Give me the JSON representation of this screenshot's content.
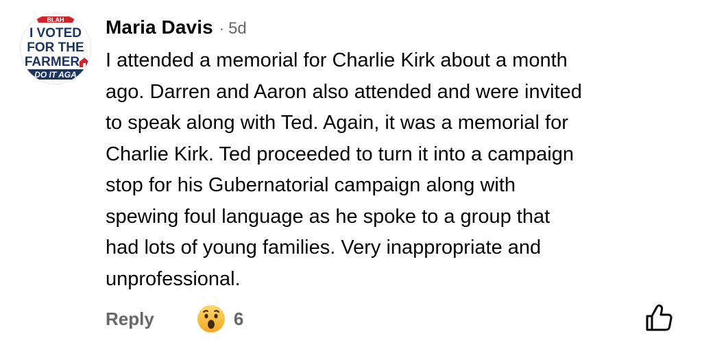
{
  "comment": {
    "avatar": {
      "line_top": "BLAH",
      "line1": "I VOTED",
      "line2": "FOR THE",
      "line3": "FARMER",
      "line4": "DO IT AGA",
      "colors": {
        "navy": "#1c3664",
        "red": "#d2232a"
      }
    },
    "author": "Maria Davis",
    "separator": "·",
    "age": "5d",
    "body_lines": [
      "I attended a memorial for Charlie Kirk about a month",
      "ago. Darren and Aaron also attended and were invited",
      "to speak along with Ted. Again, it was a memorial for",
      "Charlie Kirk. Ted proceeded to turn it into a campaign",
      "stop for his Gubernatorial campaign along with",
      "spewing foul language as he spoke to a group that",
      "had lots of young families. Very inappropriate and",
      "unprofessional."
    ],
    "reply_label": "Reply",
    "reaction": {
      "icon": "wow-emoji-icon",
      "count": "6"
    },
    "like_icon": "thumbs-up-outline-icon"
  }
}
